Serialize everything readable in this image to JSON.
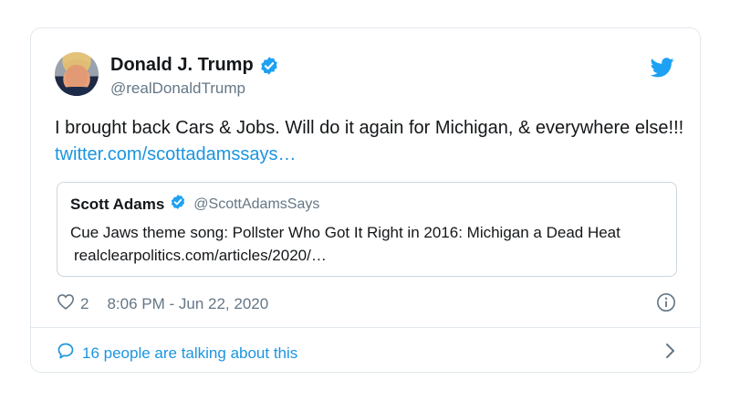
{
  "author": {
    "display_name": "Donald J. Trump",
    "handle": "@realDonaldTrump",
    "verified": true,
    "avatar_icon": "profile-photo"
  },
  "tweet": {
    "text": "I brought back Cars & Jobs. Will do it again for Michigan, & everywhere else!!!",
    "link": "twitter.com/scottadamssays…"
  },
  "quoted_tweet": {
    "display_name": "Scott Adams",
    "handle": "@ScottAdamsSays",
    "verified": true,
    "text": "Cue Jaws theme song: Pollster Who Got It Right in 2016: Michigan a Dead Heat",
    "link": "realclearpolitics.com/articles/2020/…"
  },
  "meta": {
    "like_count": "2",
    "timestamp": "8:06 PM - Jun 22, 2020"
  },
  "footer": {
    "conversation_label": "16 people are talking about this"
  },
  "colors": {
    "accent": "#1b95e0",
    "secondary_text": "#657786",
    "border": "#e1e8ed"
  },
  "icons": [
    "verified-badge-icon",
    "twitter-bird-icon",
    "heart-icon",
    "info-icon",
    "comment-bubble-icon",
    "chevron-right-icon"
  ]
}
